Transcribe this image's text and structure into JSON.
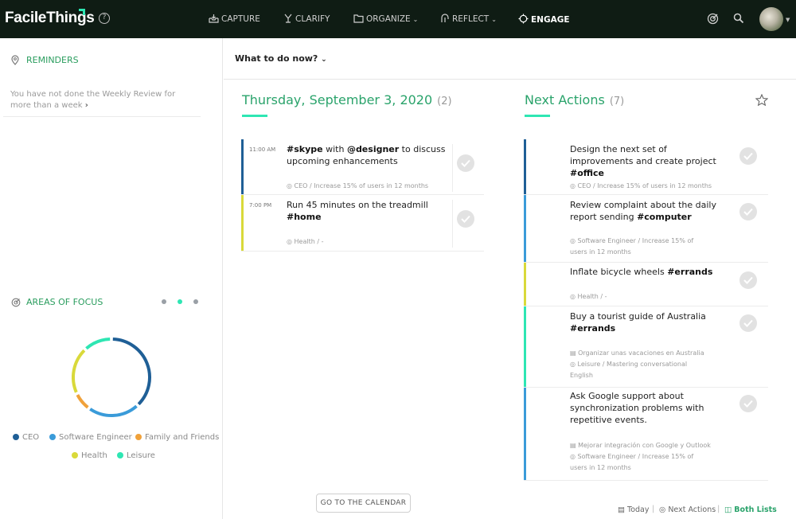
{
  "app": {
    "logo": "FacileThings"
  },
  "nav": [
    {
      "label": "CAPTURE",
      "icon": "inbox-icon",
      "caret": false,
      "active": false
    },
    {
      "label": "CLARIFY",
      "icon": "clarify-icon",
      "caret": false,
      "active": false
    },
    {
      "label": "ORGANIZE",
      "icon": "folder-icon",
      "caret": true,
      "active": false
    },
    {
      "label": "REFLECT",
      "icon": "reflect-icon",
      "caret": true,
      "active": false
    },
    {
      "label": "ENGAGE",
      "icon": "crosshair-icon",
      "caret": false,
      "active": true
    }
  ],
  "reminders": {
    "title": "REMINDERS",
    "text": "You have not done the Weekly Review for more than a week"
  },
  "areas": {
    "title": "AREAS OF FOCUS",
    "legend": [
      {
        "label": "CEO",
        "color": "#1f5f96"
      },
      {
        "label": "Software Engineer",
        "color": "#3a9bd9"
      },
      {
        "label": "Family and Friends",
        "color": "#f0a13a"
      },
      {
        "label": "Health",
        "color": "#d9d93a"
      },
      {
        "label": "Leisure",
        "color": "#2ee6b3"
      }
    ],
    "donut_fractions": [
      0.38,
      0.22,
      0.08,
      0.2,
      0.12
    ]
  },
  "header": {
    "what_to_do": "What to do now?"
  },
  "today": {
    "title": "Thursday, September 3, 2020",
    "count": "(2)",
    "items": [
      {
        "time": "11:00 AM",
        "title_html": "<b>#skype</b> with <b>@designer</b> to discuss upcoming enhancements",
        "meta": [
          "CEO / Increase 15% of users in 12 months"
        ],
        "color": "#1f5f96"
      },
      {
        "time": "7:00 PM",
        "title_html": "Run 45 minutes on the treadmill <b>#home</b>",
        "meta": [
          "Health / -"
        ],
        "color": "#d9d93a"
      }
    ]
  },
  "next_actions": {
    "title": "Next Actions",
    "count": "(7)",
    "items": [
      {
        "title_html": "Design the next set of improvements and create project <b>#office</b>",
        "meta": [
          "CEO / Increase 15% of users in 12 months"
        ],
        "color": "#1f5f96"
      },
      {
        "title_html": "Review complaint about the daily report sending <b>#computer</b>",
        "meta": [
          "Software Engineer / Increase 15% of",
          "users in 12 months"
        ],
        "color": "#3a9bd9"
      },
      {
        "title_html": "Inflate bicycle wheels <b>#errands</b>",
        "meta": [
          "Health / -"
        ],
        "color": "#d9d93a"
      },
      {
        "title_html": "Buy a tourist guide of Australia <b>#errands</b>",
        "meta": [
          "Organizar unas vacaciones en Australia",
          "Leisure / Mastering conversational",
          "English"
        ],
        "color": "#2ee6b3"
      },
      {
        "title_html": "Ask Google support about synchronization problems with repetitive events.",
        "meta": [
          "Mejorar integración con Google y Outlook",
          "Software Engineer / Increase 15% of",
          "users in 12 months"
        ],
        "color": "#3a9bd9"
      }
    ]
  },
  "footer": {
    "calendar_button": "GO TO THE CALENDAR",
    "views": [
      "Today",
      "Next Actions",
      "Both Lists"
    ]
  }
}
